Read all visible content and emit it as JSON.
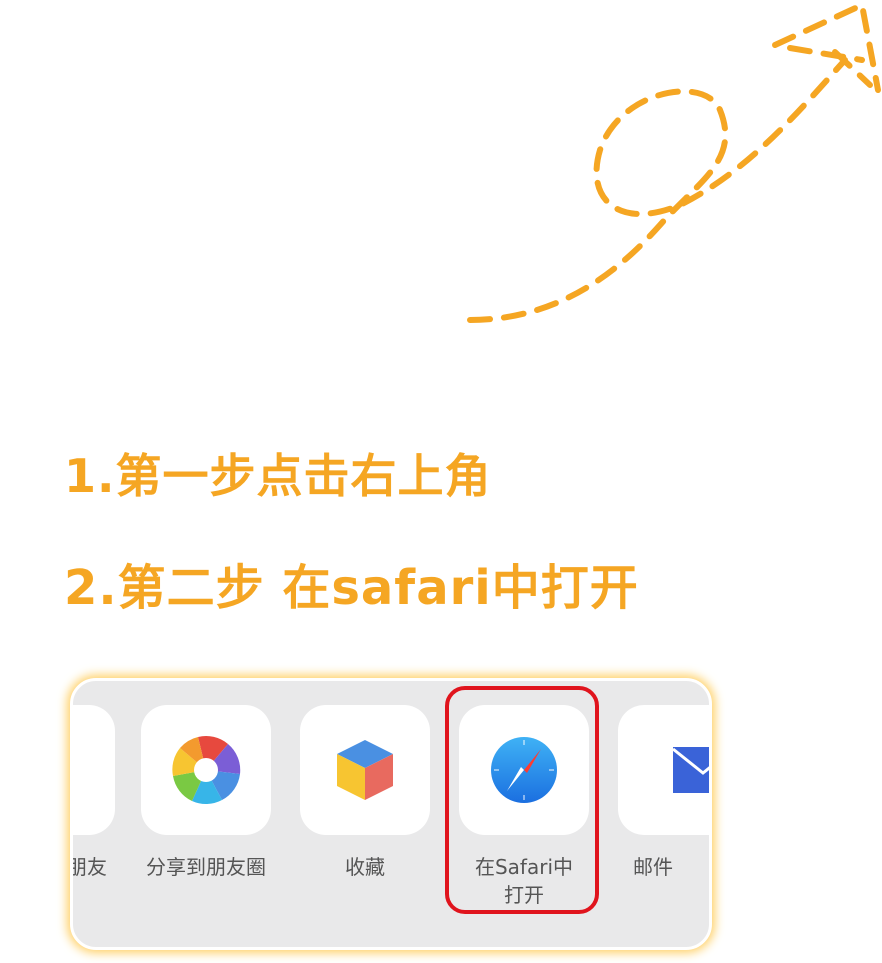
{
  "instructions": {
    "step1": "1.第一步点击右上角",
    "step2": "2.第二步 在safari中打开"
  },
  "colors": {
    "accent": "#f5a623",
    "highlight": "#e0141d",
    "panel_bg": "#e9e9ea"
  },
  "share_sheet": {
    "items": [
      {
        "label": "朋友",
        "icon": "partial-tile"
      },
      {
        "label": "分享到朋友圈",
        "icon": "moments-aperture-icon"
      },
      {
        "label": "收藏",
        "icon": "favorites-cube-icon"
      },
      {
        "label": "在Safari中\n打开",
        "icon": "safari-compass-icon"
      },
      {
        "label": "邮件",
        "icon": "mail-envelope-icon"
      }
    ]
  }
}
